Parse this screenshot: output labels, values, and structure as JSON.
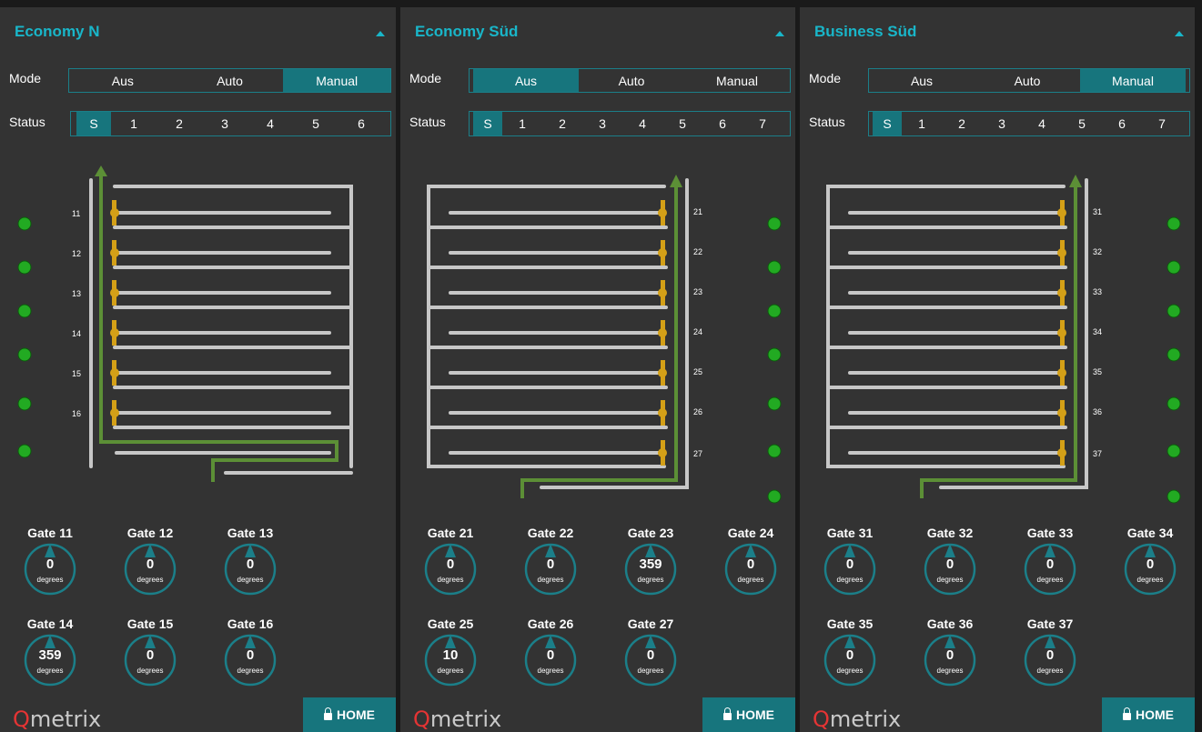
{
  "colors": {
    "accent": "#19b6c9",
    "button": "#17757d",
    "path_green": "#5c8f36",
    "gate_gold": "#d4a017",
    "led_green": "#22aa22",
    "rail_gray": "#c7c7c7"
  },
  "panels": [
    {
      "title": "Economy N",
      "mode_label": "Mode",
      "status_label": "Status",
      "modes": [
        "Aus",
        "Auto",
        "Manual"
      ],
      "active_mode": "Manual",
      "status": [
        "S",
        "1",
        "2",
        "3",
        "4",
        "5",
        "6"
      ],
      "active_status": "S",
      "gate_numbers": [
        "11",
        "12",
        "13",
        "14",
        "15",
        "16"
      ],
      "gates": [
        {
          "name": "Gate 11",
          "value": "0",
          "unit": "degrees"
        },
        {
          "name": "Gate 12",
          "value": "0",
          "unit": "degrees"
        },
        {
          "name": "Gate 13",
          "value": "0",
          "unit": "degrees"
        },
        {
          "name": "Gate 14",
          "value": "359",
          "unit": "degrees"
        },
        {
          "name": "Gate 15",
          "value": "0",
          "unit": "degrees"
        },
        {
          "name": "Gate 16",
          "value": "0",
          "unit": "degrees"
        }
      ],
      "logo": {
        "q": "Q",
        "rest": "metrix"
      },
      "home_label": "HOME"
    },
    {
      "title": "Economy Süd",
      "mode_label": "Mode",
      "status_label": "Status",
      "modes": [
        "Aus",
        "Auto",
        "Manual"
      ],
      "active_mode": "Aus",
      "status": [
        "S",
        "1",
        "2",
        "3",
        "4",
        "5",
        "6",
        "7"
      ],
      "active_status": "S",
      "gate_numbers": [
        "21",
        "22",
        "23",
        "24",
        "25",
        "26",
        "27"
      ],
      "gates": [
        {
          "name": "Gate 21",
          "value": "0",
          "unit": "degrees"
        },
        {
          "name": "Gate 22",
          "value": "0",
          "unit": "degrees"
        },
        {
          "name": "Gate 23",
          "value": "359",
          "unit": "degrees"
        },
        {
          "name": "Gate 24",
          "value": "0",
          "unit": "degrees"
        },
        {
          "name": "Gate 25",
          "value": "10",
          "unit": "degrees"
        },
        {
          "name": "Gate 26",
          "value": "0",
          "unit": "degrees"
        },
        {
          "name": "Gate 27",
          "value": "0",
          "unit": "degrees"
        }
      ],
      "logo": {
        "q": "Q",
        "rest": "metrix"
      },
      "home_label": "HOME"
    },
    {
      "title": "Business Süd",
      "mode_label": "Mode",
      "status_label": "Status",
      "modes": [
        "Aus",
        "Auto",
        "Manual"
      ],
      "active_mode": "Manual",
      "status": [
        "S",
        "1",
        "2",
        "3",
        "4",
        "5",
        "6",
        "7"
      ],
      "active_status": "S",
      "gate_numbers": [
        "31",
        "32",
        "33",
        "34",
        "35",
        "36",
        "37"
      ],
      "gates": [
        {
          "name": "Gate 31",
          "value": "0",
          "unit": "degrees"
        },
        {
          "name": "Gate 32",
          "value": "0",
          "unit": "degrees"
        },
        {
          "name": "Gate 33",
          "value": "0",
          "unit": "degrees"
        },
        {
          "name": "Gate 34",
          "value": "0",
          "unit": "degrees"
        },
        {
          "name": "Gate 35",
          "value": "0",
          "unit": "degrees"
        },
        {
          "name": "Gate 36",
          "value": "0",
          "unit": "degrees"
        },
        {
          "name": "Gate 37",
          "value": "0",
          "unit": "degrees"
        }
      ],
      "logo": {
        "q": "Q",
        "rest": "metrix"
      },
      "home_label": "HOME"
    }
  ]
}
